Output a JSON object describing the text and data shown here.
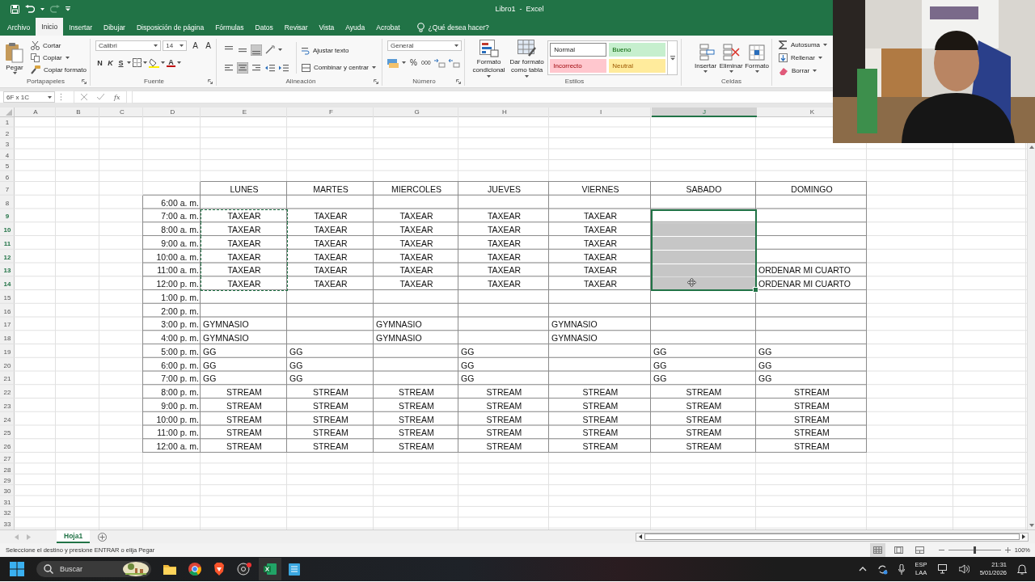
{
  "title_bar": {
    "title": "Libro1  -  Excel"
  },
  "tabs": [
    {
      "label": "Archivo",
      "selected": false
    },
    {
      "label": "Inicio",
      "selected": true
    },
    {
      "label": "Insertar",
      "selected": false
    },
    {
      "label": "Dibujar",
      "selected": false
    },
    {
      "label": "Disposición de página",
      "selected": false
    },
    {
      "label": "Fórmulas",
      "selected": false
    },
    {
      "label": "Datos",
      "selected": false
    },
    {
      "label": "Revisar",
      "selected": false
    },
    {
      "label": "Vista",
      "selected": false
    },
    {
      "label": "Ayuda",
      "selected": false
    },
    {
      "label": "Acrobat",
      "selected": false
    }
  ],
  "tell_me": "¿Qué desea hacer?",
  "ribbon": {
    "groups": [
      {
        "kind": "clipboard",
        "label": "Portapapeles",
        "paste": "Pegar",
        "actions": [
          "Cortar",
          "Copiar",
          "Copiar formato"
        ]
      },
      {
        "kind": "font",
        "label": "Fuente",
        "font": "Calibri",
        "size": "14",
        "size_buttons": [
          "A",
          "A"
        ],
        "style_buttons": [
          "N",
          "K",
          "S"
        ],
        "font_color": "A"
      },
      {
        "kind": "alignment",
        "label": "Alineación",
        "actions": [
          "Ajustar texto",
          "Combinar y centrar"
        ]
      },
      {
        "kind": "number",
        "label": "Número",
        "format": "General",
        "buttons": [
          "%",
          "000"
        ]
      },
      {
        "kind": "styles",
        "label": "Estilos",
        "actions": [
          "Formato condicional",
          "Dar formato como tabla"
        ],
        "cell_styles": [
          {
            "label": "Normal",
            "color": "#ffffff"
          },
          {
            "label": "Bueno",
            "color": "#c6efce"
          },
          {
            "label": "Incorrecto",
            "color": "#ffc7ce"
          },
          {
            "label": "Neutral",
            "color": "#ffeb9c"
          }
        ]
      },
      {
        "kind": "cells",
        "label": "Celdas",
        "actions": [
          "Insertar",
          "Eliminar",
          "Formato"
        ]
      },
      {
        "kind": "editing",
        "actions": [
          "Autosuma",
          "Rellenar",
          "Borrar"
        ]
      }
    ]
  },
  "formula_bar": {
    "name_box": "6F x 1C",
    "function_label": "fx"
  },
  "sheet": {
    "columns": [
      "A",
      "B",
      "C",
      "D",
      "E",
      "F",
      "G",
      "H",
      "I",
      "J",
      "K"
    ],
    "rows": [
      "1",
      "2",
      "3",
      "4",
      "5",
      "6",
      "7",
      "8",
      "9",
      "10",
      "11",
      "12",
      "13",
      "14",
      "15",
      "16",
      "17",
      "18",
      "19",
      "20",
      "21",
      "22",
      "23",
      "24",
      "25",
      "26",
      "27",
      "28",
      "29",
      "30",
      "31",
      "32",
      "33"
    ]
  },
  "schedule": {
    "days": [
      {
        "label": "LUNES",
        "selected": false,
        "copied": true
      },
      {
        "label": "MARTES",
        "selected": false,
        "copied": false
      },
      {
        "label": "MIERCOLES",
        "selected": false,
        "copied": false
      },
      {
        "label": "JUEVES",
        "selected": false,
        "copied": false
      },
      {
        "label": "VIERNES",
        "selected": false,
        "copied": false
      },
      {
        "label": "SABADO",
        "selected": true,
        "copied": false
      },
      {
        "label": "DOMINGO",
        "selected": false,
        "copied": false
      }
    ],
    "slots": [
      {
        "time": "6:00 a. m.",
        "selected": false,
        "copied": false,
        "entries": [
          {
            "kind": "blank"
          },
          {
            "kind": "blank"
          },
          {
            "kind": "blank"
          },
          {
            "kind": "blank"
          },
          {
            "kind": "blank"
          },
          {
            "kind": "blank"
          },
          {
            "kind": "blank"
          }
        ]
      },
      {
        "time": "7:00 a. m.",
        "selected": true,
        "copied": true,
        "entries": [
          {
            "kind": "centered",
            "text": "TAXEAR"
          },
          {
            "kind": "centered",
            "text": "TAXEAR"
          },
          {
            "kind": "centered",
            "text": "TAXEAR"
          },
          {
            "kind": "centered",
            "text": "TAXEAR"
          },
          {
            "kind": "centered",
            "text": "TAXEAR"
          },
          {
            "kind": "blank"
          },
          {
            "kind": "blank"
          }
        ]
      },
      {
        "time": "8:00 a. m.",
        "selected": true,
        "copied": true,
        "entries": [
          {
            "kind": "centered",
            "text": "TAXEAR"
          },
          {
            "kind": "centered",
            "text": "TAXEAR"
          },
          {
            "kind": "centered",
            "text": "TAXEAR"
          },
          {
            "kind": "centered",
            "text": "TAXEAR"
          },
          {
            "kind": "centered",
            "text": "TAXEAR"
          },
          {
            "kind": "blank"
          },
          {
            "kind": "blank"
          }
        ]
      },
      {
        "time": "9:00 a. m.",
        "selected": true,
        "copied": true,
        "entries": [
          {
            "kind": "centered",
            "text": "TAXEAR"
          },
          {
            "kind": "centered",
            "text": "TAXEAR"
          },
          {
            "kind": "centered",
            "text": "TAXEAR"
          },
          {
            "kind": "centered",
            "text": "TAXEAR"
          },
          {
            "kind": "centered",
            "text": "TAXEAR"
          },
          {
            "kind": "blank"
          },
          {
            "kind": "blank"
          }
        ]
      },
      {
        "time": "10:00 a. m.",
        "selected": true,
        "copied": true,
        "entries": [
          {
            "kind": "centered",
            "text": "TAXEAR"
          },
          {
            "kind": "centered",
            "text": "TAXEAR"
          },
          {
            "kind": "centered",
            "text": "TAXEAR"
          },
          {
            "kind": "centered",
            "text": "TAXEAR"
          },
          {
            "kind": "centered",
            "text": "TAXEAR"
          },
          {
            "kind": "blank"
          },
          {
            "kind": "blank"
          }
        ]
      },
      {
        "time": "11:00 a. m.",
        "selected": true,
        "copied": true,
        "entries": [
          {
            "kind": "centered",
            "text": "TAXEAR"
          },
          {
            "kind": "centered",
            "text": "TAXEAR"
          },
          {
            "kind": "centered",
            "text": "TAXEAR"
          },
          {
            "kind": "centered",
            "text": "TAXEAR"
          },
          {
            "kind": "centered",
            "text": "TAXEAR"
          },
          {
            "kind": "blank"
          },
          {
            "kind": "left",
            "text": "ORDENAR MI CUARTO"
          }
        ]
      },
      {
        "time": "12:00 p. m.",
        "selected": true,
        "copied": true,
        "entries": [
          {
            "kind": "centered",
            "text": "TAXEAR"
          },
          {
            "kind": "centered",
            "text": "TAXEAR"
          },
          {
            "kind": "centered",
            "text": "TAXEAR"
          },
          {
            "kind": "centered",
            "text": "TAXEAR"
          },
          {
            "kind": "centered",
            "text": "TAXEAR"
          },
          {
            "kind": "blank"
          },
          {
            "kind": "left",
            "text": "ORDENAR MI CUARTO"
          }
        ]
      },
      {
        "time": "1:00 p. m.",
        "selected": false,
        "copied": false,
        "entries": [
          {
            "kind": "blank"
          },
          {
            "kind": "blank"
          },
          {
            "kind": "blank"
          },
          {
            "kind": "blank"
          },
          {
            "kind": "blank"
          },
          {
            "kind": "blank"
          },
          {
            "kind": "blank"
          }
        ]
      },
      {
        "time": "2:00 p. m.",
        "selected": false,
        "copied": false,
        "entries": [
          {
            "kind": "blank"
          },
          {
            "kind": "blank"
          },
          {
            "kind": "blank"
          },
          {
            "kind": "blank"
          },
          {
            "kind": "blank"
          },
          {
            "kind": "blank"
          },
          {
            "kind": "blank"
          }
        ]
      },
      {
        "time": "3:00 p. m.",
        "selected": false,
        "copied": false,
        "entries": [
          {
            "kind": "left",
            "text": "GYMNASIO"
          },
          {
            "kind": "blank"
          },
          {
            "kind": "left",
            "text": "GYMNASIO"
          },
          {
            "kind": "blank"
          },
          {
            "kind": "left",
            "text": "GYMNASIO"
          },
          {
            "kind": "blank"
          },
          {
            "kind": "blank"
          }
        ]
      },
      {
        "time": "4:00 p. m.",
        "selected": false,
        "copied": false,
        "entries": [
          {
            "kind": "left",
            "text": "GYMNASIO"
          },
          {
            "kind": "blank"
          },
          {
            "kind": "left",
            "text": "GYMNASIO"
          },
          {
            "kind": "blank"
          },
          {
            "kind": "left",
            "text": "GYMNASIO"
          },
          {
            "kind": "blank"
          },
          {
            "kind": "blank"
          }
        ]
      },
      {
        "time": "5:00 p. m.",
        "selected": false,
        "copied": false,
        "entries": [
          {
            "kind": "left",
            "text": "GG"
          },
          {
            "kind": "left",
            "text": "GG"
          },
          {
            "kind": "blank"
          },
          {
            "kind": "left",
            "text": "GG"
          },
          {
            "kind": "blank"
          },
          {
            "kind": "left",
            "text": "GG"
          },
          {
            "kind": "left",
            "text": "GG"
          }
        ]
      },
      {
        "time": "6:00 p. m.",
        "selected": false,
        "copied": false,
        "entries": [
          {
            "kind": "left",
            "text": "GG"
          },
          {
            "kind": "left",
            "text": "GG"
          },
          {
            "kind": "blank"
          },
          {
            "kind": "left",
            "text": "GG"
          },
          {
            "kind": "blank"
          },
          {
            "kind": "left",
            "text": "GG"
          },
          {
            "kind": "left",
            "text": "GG"
          }
        ]
      },
      {
        "time": "7:00 p. m.",
        "selected": false,
        "copied": false,
        "entries": [
          {
            "kind": "left",
            "text": "GG"
          },
          {
            "kind": "left",
            "text": "GG"
          },
          {
            "kind": "blank"
          },
          {
            "kind": "left",
            "text": "GG"
          },
          {
            "kind": "blank"
          },
          {
            "kind": "left",
            "text": "GG"
          },
          {
            "kind": "left",
            "text": "GG"
          }
        ]
      },
      {
        "time": "8:00 p. m.",
        "selected": false,
        "copied": false,
        "entries": [
          {
            "kind": "centered",
            "text": "STREAM"
          },
          {
            "kind": "centered",
            "text": "STREAM"
          },
          {
            "kind": "centered",
            "text": "STREAM"
          },
          {
            "kind": "centered",
            "text": "STREAM"
          },
          {
            "kind": "centered",
            "text": "STREAM"
          },
          {
            "kind": "centered",
            "text": "STREAM"
          },
          {
            "kind": "centered",
            "text": "STREAM"
          }
        ]
      },
      {
        "time": "9:00 p. m.",
        "selected": false,
        "copied": false,
        "entries": [
          {
            "kind": "centered",
            "text": "STREAM"
          },
          {
            "kind": "centered",
            "text": "STREAM"
          },
          {
            "kind": "centered",
            "text": "STREAM"
          },
          {
            "kind": "centered",
            "text": "STREAM"
          },
          {
            "kind": "centered",
            "text": "STREAM"
          },
          {
            "kind": "centered",
            "text": "STREAM"
          },
          {
            "kind": "centered",
            "text": "STREAM"
          }
        ]
      },
      {
        "time": "10:00 p. m.",
        "selected": false,
        "copied": false,
        "entries": [
          {
            "kind": "centered",
            "text": "STREAM"
          },
          {
            "kind": "centered",
            "text": "STREAM"
          },
          {
            "kind": "centered",
            "text": "STREAM"
          },
          {
            "kind": "centered",
            "text": "STREAM"
          },
          {
            "kind": "centered",
            "text": "STREAM"
          },
          {
            "kind": "centered",
            "text": "STREAM"
          },
          {
            "kind": "centered",
            "text": "STREAM"
          }
        ]
      },
      {
        "time": "11:00 p. m.",
        "selected": false,
        "copied": false,
        "entries": [
          {
            "kind": "centered",
            "text": "STREAM"
          },
          {
            "kind": "centered",
            "text": "STREAM"
          },
          {
            "kind": "centered",
            "text": "STREAM"
          },
          {
            "kind": "centered",
            "text": "STREAM"
          },
          {
            "kind": "centered",
            "text": "STREAM"
          },
          {
            "kind": "centered",
            "text": "STREAM"
          },
          {
            "kind": "centered",
            "text": "STREAM"
          }
        ]
      },
      {
        "time": "12:00 a. m.",
        "selected": false,
        "copied": false,
        "entries": [
          {
            "kind": "centered",
            "text": "STREAM"
          },
          {
            "kind": "centered",
            "text": "STREAM"
          },
          {
            "kind": "centered",
            "text": "STREAM"
          },
          {
            "kind": "centered",
            "text": "STREAM"
          },
          {
            "kind": "centered",
            "text": "STREAM"
          },
          {
            "kind": "centered",
            "text": "STREAM"
          },
          {
            "kind": "centered",
            "text": "STREAM"
          }
        ]
      }
    ]
  },
  "sheet_tabs": [
    {
      "label": "Hoja1",
      "selected": true
    }
  ],
  "status_bar": {
    "message": "Seleccione el destino y presione ENTRAR o elija Pegar",
    "zoom": {
      "level": 0.5,
      "reading": "100%"
    }
  },
  "taskbar": {
    "search": {
      "placeholder": "Buscar"
    },
    "language": [
      "ESP",
      "LAA"
    ],
    "time": "21:31",
    "date": "5/01/2026"
  }
}
